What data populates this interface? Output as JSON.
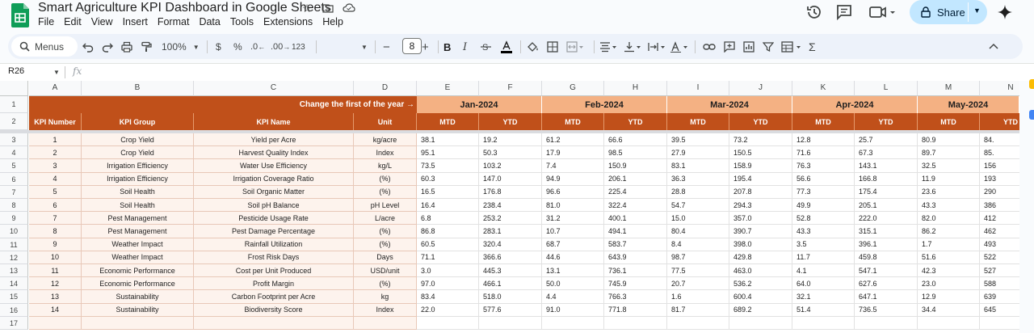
{
  "title": "Smart Agriculture KPI Dashboard in Google Sheets",
  "menu": [
    "File",
    "Edit",
    "View",
    "Insert",
    "Format",
    "Data",
    "Tools",
    "Extensions",
    "Help"
  ],
  "share_label": "Share",
  "toolbar": {
    "menus_label": "Menus",
    "zoom": "100%",
    "currency": "$",
    "percent": "%",
    "decimal_less": ".0",
    "decimal_more": ".00",
    "number_format": "123",
    "font_size": "8",
    "minus": "−",
    "plus": "+",
    "bold": "B",
    "italic": "I",
    "sigma": "Σ"
  },
  "name_box": "R26",
  "columns": [
    "A",
    "B",
    "C",
    "D",
    "E",
    "F",
    "G",
    "H",
    "I",
    "J",
    "K",
    "L",
    "M",
    "N"
  ],
  "banner": "Change the first of the year →",
  "months": [
    "Jan-2024",
    "Feb-2024",
    "Mar-2024",
    "Apr-2024",
    "May-2024"
  ],
  "headers": [
    "KPI Number",
    "KPI Group",
    "KPI Name",
    "Unit"
  ],
  "mtd": "MTD",
  "ytd": "YTD",
  "row_numbers": [
    "1",
    "2",
    "3",
    "4",
    "5",
    "6",
    "7",
    "8",
    "9",
    "10",
    "11",
    "12",
    "13",
    "14",
    "15",
    "16",
    "17"
  ],
  "rows": [
    {
      "num": "1",
      "group": "Crop Yield",
      "name": "Yield per Acre",
      "unit": "kg/acre",
      "vals": [
        "38.1",
        "19.2",
        "61.2",
        "66.6",
        "39.5",
        "73.2",
        "12.8",
        "25.7",
        "80.9",
        "84."
      ]
    },
    {
      "num": "2",
      "group": "Crop Yield",
      "name": "Harvest Quality Index",
      "unit": "Index",
      "vals": [
        "95.1",
        "50.3",
        "17.9",
        "98.5",
        "27.9",
        "150.5",
        "71.6",
        "67.3",
        "89.7",
        "85."
      ]
    },
    {
      "num": "3",
      "group": "Irrigation Efficiency",
      "name": "Water Use Efficiency",
      "unit": "kg/L",
      "vals": [
        "73.5",
        "103.2",
        "7.4",
        "150.9",
        "83.1",
        "158.9",
        "76.3",
        "143.1",
        "32.5",
        "156"
      ]
    },
    {
      "num": "4",
      "group": "Irrigation Efficiency",
      "name": "Irrigation Coverage Ratio",
      "unit": "(%)",
      "vals": [
        "60.3",
        "147.0",
        "94.9",
        "206.1",
        "36.3",
        "195.4",
        "56.6",
        "166.8",
        "11.9",
        "193"
      ]
    },
    {
      "num": "5",
      "group": "Soil Health",
      "name": "Soil Organic Matter",
      "unit": "(%)",
      "vals": [
        "16.5",
        "176.8",
        "96.6",
        "225.4",
        "28.8",
        "207.8",
        "77.3",
        "175.4",
        "23.6",
        "290"
      ]
    },
    {
      "num": "6",
      "group": "Soil Health",
      "name": "Soil pH Balance",
      "unit": "pH Level",
      "vals": [
        "16.4",
        "238.4",
        "81.0",
        "322.4",
        "54.7",
        "294.3",
        "49.9",
        "205.1",
        "43.3",
        "386"
      ]
    },
    {
      "num": "7",
      "group": "Pest Management",
      "name": "Pesticide Usage Rate",
      "unit": "L/acre",
      "vals": [
        "6.8",
        "253.2",
        "31.2",
        "400.1",
        "15.0",
        "357.0",
        "52.8",
        "222.0",
        "82.0",
        "412"
      ]
    },
    {
      "num": "8",
      "group": "Pest Management",
      "name": "Pest Damage Percentage",
      "unit": "(%)",
      "vals": [
        "86.8",
        "283.1",
        "10.7",
        "494.1",
        "80.4",
        "390.7",
        "43.3",
        "315.1",
        "86.2",
        "462"
      ]
    },
    {
      "num": "9",
      "group": "Weather Impact",
      "name": "Rainfall Utilization",
      "unit": "(%)",
      "vals": [
        "60.5",
        "320.4",
        "68.7",
        "583.7",
        "8.4",
        "398.0",
        "3.5",
        "396.1",
        "1.7",
        "493"
      ]
    },
    {
      "num": "10",
      "group": "Weather Impact",
      "name": "Frost Risk Days",
      "unit": "Days",
      "vals": [
        "71.1",
        "366.6",
        "44.6",
        "643.9",
        "98.7",
        "429.8",
        "11.7",
        "459.8",
        "51.6",
        "522"
      ]
    },
    {
      "num": "11",
      "group": "Economic Performance",
      "name": "Cost per Unit Produced",
      "unit": "USD/unit",
      "vals": [
        "3.0",
        "445.3",
        "13.1",
        "736.1",
        "77.5",
        "463.0",
        "4.1",
        "547.1",
        "42.3",
        "527"
      ]
    },
    {
      "num": "12",
      "group": "Economic Performance",
      "name": "Profit Margin",
      "unit": "(%)",
      "vals": [
        "97.0",
        "466.1",
        "50.0",
        "745.9",
        "20.7",
        "536.2",
        "64.0",
        "627.6",
        "23.0",
        "588"
      ]
    },
    {
      "num": "13",
      "group": "Sustainability",
      "name": "Carbon Footprint per Acre",
      "unit": "kg",
      "vals": [
        "83.4",
        "518.0",
        "4.4",
        "766.3",
        "1.6",
        "600.4",
        "32.1",
        "647.1",
        "12.9",
        "639"
      ]
    },
    {
      "num": "14",
      "group": "Sustainability",
      "name": "Biodiversity Score",
      "unit": "Index",
      "vals": [
        "22.0",
        "577.6",
        "91.0",
        "771.8",
        "81.7",
        "689.2",
        "51.4",
        "736.5",
        "34.4",
        "645"
      ]
    }
  ],
  "colors": {
    "header_dark": "#c0501a",
    "header_light": "#f4b183",
    "left_bg": "#fdf3ed",
    "share_bg": "#c2e7ff",
    "sheets_green": "#0f9d58"
  }
}
